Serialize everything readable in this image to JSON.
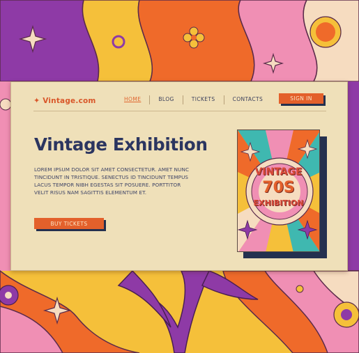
{
  "brand": {
    "star": "✦",
    "name": "Vintage.com"
  },
  "nav": {
    "items": [
      {
        "label": "HOME",
        "active": true
      },
      {
        "label": "BLOG",
        "active": false
      },
      {
        "label": "TICKETS",
        "active": false
      },
      {
        "label": "CONTACTS",
        "active": false
      }
    ],
    "signin_label": "SIGN IN"
  },
  "hero": {
    "title": "Vintage Exhibition",
    "body": "LOREM IPSUM DOLOR SIT AMET CONSECTETUR. AMET NUNC TINCIDUNT IN TRISTIQUE. SENECTUS ID TINCIDUNT TEMPUS LACUS TEMPOR NIBH EGESTAS SIT POSUERE. PORTTITOR VELIT RISUS NAM SAGITTIS ELEMENTUM ET.",
    "cta_label": "BUY TICKETS"
  },
  "poster": {
    "line1": "VINTAGE",
    "line2": "70S",
    "line3": "EXHIBITION"
  },
  "colors": {
    "accent": "#e3602b",
    "navy": "#2b3560",
    "panel": "#efe0b9",
    "purple": "#8e3aa6",
    "pink": "#f08fb4",
    "yellow": "#f5c03a",
    "orange": "#ef6a2a"
  },
  "icons": [
    "star-icon",
    "flower-icon",
    "sparkle-icon"
  ]
}
